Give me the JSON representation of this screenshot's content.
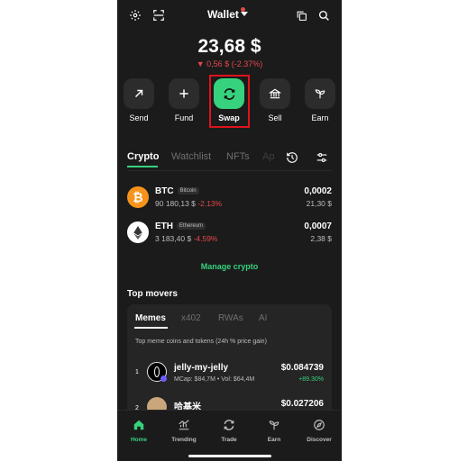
{
  "header": {
    "title": "Wallet"
  },
  "balance": {
    "amount": "23,68 $",
    "change": "▼ 0,56 $ (-2.37%)"
  },
  "actions": [
    {
      "label": "Send"
    },
    {
      "label": "Fund"
    },
    {
      "label": "Swap"
    },
    {
      "label": "Sell"
    },
    {
      "label": "Earn"
    }
  ],
  "tabs": [
    "Crypto",
    "Watchlist",
    "NFTs",
    "Ap"
  ],
  "assets": [
    {
      "symbol": "BTC",
      "name": "Bitcoin",
      "price": "90 180,13 $",
      "change": "-2.13%",
      "amount": "0,0002",
      "value": "21,30 $"
    },
    {
      "symbol": "ETH",
      "name": "Ethereum",
      "price": "3 183,40 $",
      "change": "-4.59%",
      "amount": "0,0007",
      "value": "2,38 $"
    }
  ],
  "manage_label": "Manage crypto",
  "top_movers": {
    "title": "Top movers",
    "tabs": [
      "Memes",
      "x402",
      "RWAs",
      "AI"
    ],
    "description": "Top meme coins and tokens (24h % price gain)",
    "items": [
      {
        "rank": "1",
        "name": "jelly-my-jelly",
        "meta": "MCap: $84,7M • Vol: $64,4M",
        "price": "$0.084739",
        "change": "+89.30%"
      },
      {
        "rank": "2",
        "name": "哈基米",
        "meta": "",
        "price": "$0.027206",
        "change": ""
      }
    ]
  },
  "nav": [
    {
      "label": "Home"
    },
    {
      "label": "Trending"
    },
    {
      "label": "Trade"
    },
    {
      "label": "Earn"
    },
    {
      "label": "Discover"
    }
  ],
  "colors": {
    "accent": "#36d27d",
    "negative": "#e5484d",
    "background": "#1b1b1b",
    "highlight_frame": "#e0121c",
    "btc": "#f7931a"
  }
}
